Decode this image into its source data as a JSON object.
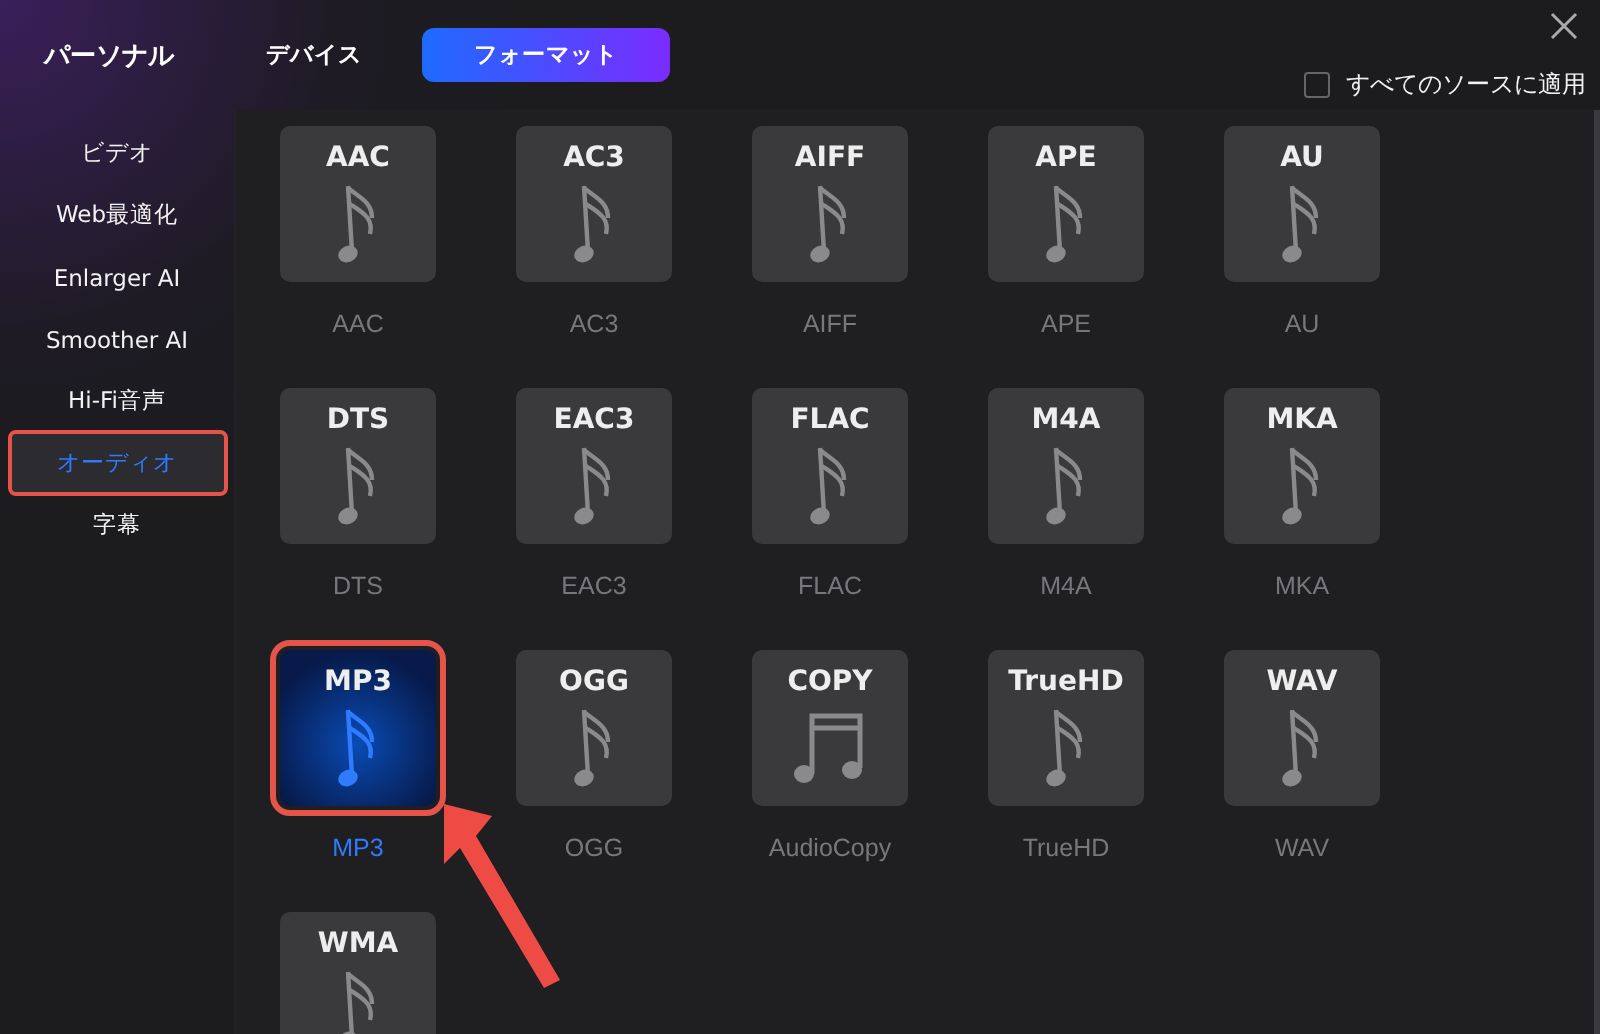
{
  "sidebar": {
    "title": "パーソナル",
    "items": [
      {
        "label": "ビデオ",
        "selected": false
      },
      {
        "label": "Web最適化",
        "selected": false
      },
      {
        "label": "Enlarger AI",
        "selected": false
      },
      {
        "label": "Smoother AI",
        "selected": false
      },
      {
        "label": "Hi-Fi音声",
        "selected": false
      },
      {
        "label": "オーディオ",
        "selected": true
      },
      {
        "label": "字幕",
        "selected": false
      }
    ]
  },
  "tabs": [
    {
      "label": "デバイス",
      "selected": false
    },
    {
      "label": "フォーマット",
      "selected": true
    }
  ],
  "apply_all": {
    "label": "すべてのソースに適用",
    "checked": false
  },
  "formats": [
    {
      "badge": "AAC",
      "label": "AAC",
      "kind": "note",
      "selected": false
    },
    {
      "badge": "AC3",
      "label": "AC3",
      "kind": "note",
      "selected": false
    },
    {
      "badge": "AIFF",
      "label": "AIFF",
      "kind": "note",
      "selected": false
    },
    {
      "badge": "APE",
      "label": "APE",
      "kind": "note",
      "selected": false
    },
    {
      "badge": "AU",
      "label": "AU",
      "kind": "note",
      "selected": false
    },
    {
      "badge": "DTS",
      "label": "DTS",
      "kind": "note",
      "selected": false
    },
    {
      "badge": "EAC3",
      "label": "EAC3",
      "kind": "note",
      "selected": false
    },
    {
      "badge": "FLAC",
      "label": "FLAC",
      "kind": "note",
      "selected": false
    },
    {
      "badge": "M4A",
      "label": "M4A",
      "kind": "note",
      "selected": false
    },
    {
      "badge": "MKA",
      "label": "MKA",
      "kind": "note",
      "selected": false
    },
    {
      "badge": "MP3",
      "label": "MP3",
      "kind": "note",
      "selected": true
    },
    {
      "badge": "OGG",
      "label": "OGG",
      "kind": "note",
      "selected": false
    },
    {
      "badge": "COPY",
      "label": "AudioCopy",
      "kind": "notes",
      "selected": false
    },
    {
      "badge": "TrueHD",
      "label": "TrueHD",
      "kind": "note",
      "selected": false
    },
    {
      "badge": "WAV",
      "label": "WAV",
      "kind": "note",
      "selected": false
    },
    {
      "badge": "WMA",
      "kind": "note",
      "selected": false
    }
  ]
}
